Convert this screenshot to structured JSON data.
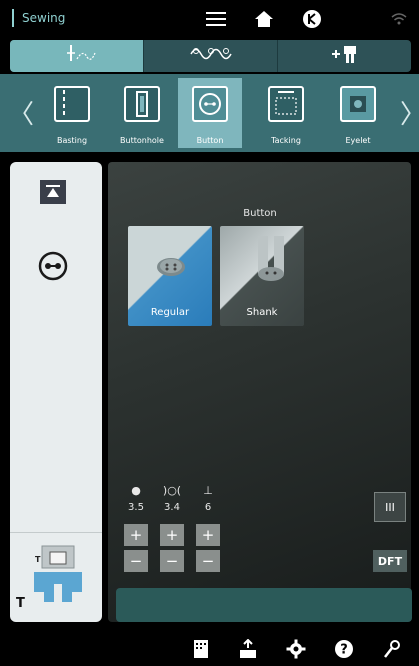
{
  "app": {
    "title": "Sewing"
  },
  "tabs": [
    {
      "name": "stitch-menu",
      "icon": "needle-stitch-icon"
    },
    {
      "name": "decorative-menu",
      "icon": "decorative-stitch-icon"
    },
    {
      "name": "add-menu",
      "icon": "plus-presser-foot-icon"
    }
  ],
  "stitches": [
    {
      "label": "Basting"
    },
    {
      "label": "Buttonhole"
    },
    {
      "label": "Button"
    },
    {
      "label": "Tacking"
    },
    {
      "label": "Eyelet"
    }
  ],
  "left_panel": {
    "foot_label": "T",
    "foot_badge": "T"
  },
  "main": {
    "title": "Button",
    "options": [
      {
        "label": "Regular"
      },
      {
        "label": "Shank"
      }
    ]
  },
  "settings": [
    {
      "icon": "button-icon",
      "value": "3.5"
    },
    {
      "icon": "stitch-width-icon",
      "value": "3.4"
    },
    {
      "icon": "presser-foot-icon",
      "value": "6"
    }
  ],
  "controls": {
    "dft_label": "DFT",
    "thread_label": "III"
  },
  "colors": {
    "accent": "#78b7bb",
    "strip": "#3a6e73",
    "selected": "#7fb6bd"
  }
}
